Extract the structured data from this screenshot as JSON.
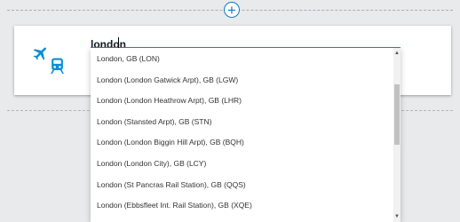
{
  "header": {
    "add_button_glyph": "+"
  },
  "search": {
    "value": "london"
  },
  "dropdown": {
    "items": [
      "London, GB (LON)",
      "London (London Gatwick Arpt), GB (LGW)",
      "London (London Heathrow Arpt), GB (LHR)",
      "London (Stansted Arpt), GB (STN)",
      "London (London Biggin Hill Arpt), GB (BQH)",
      "London (London City), GB (LCY)",
      "London (St Pancras Rail Station), GB (QQS)",
      "London (Ebbsfleet Int. Rail Station), GB (XQE)"
    ],
    "scroll_up_glyph": "▲",
    "scroll_down_glyph": "▼"
  },
  "icons": {
    "transport_icons": [
      "airplane-icon",
      "train-icon"
    ]
  },
  "colors": {
    "accent": "#0b8fd6",
    "background": "#e9eaeb"
  }
}
